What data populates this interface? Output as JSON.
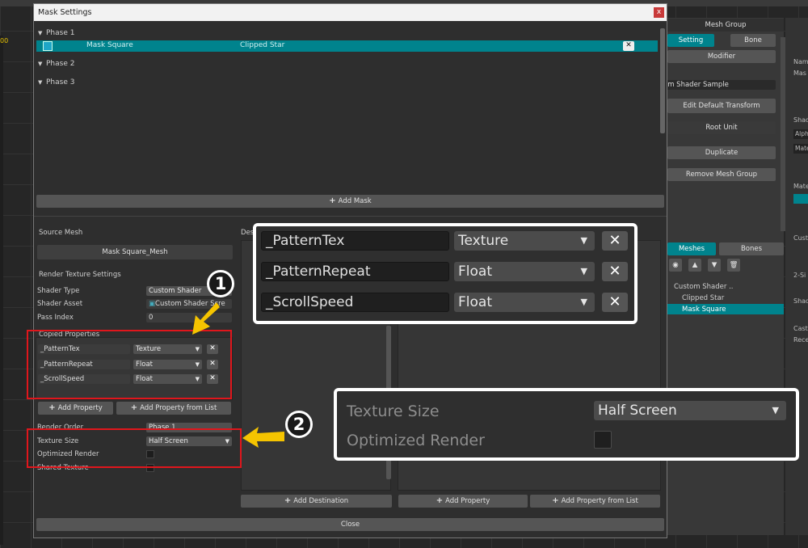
{
  "dialog": {
    "title": "Mask Settings",
    "close_glyph": "x",
    "phases": [
      {
        "label": "Phase 1",
        "expanded": true
      },
      {
        "label": "Phase 2",
        "expanded": true
      },
      {
        "label": "Phase 3",
        "expanded": true
      }
    ],
    "mask_row": {
      "name": "Mask Square",
      "target": "Clipped Star"
    },
    "add_mask": "Add Mask",
    "close_button": "Close"
  },
  "source": {
    "title": "Source Mesh",
    "mesh_name": "Mask Square_Mesh",
    "render_texture_settings": "Render Texture Settings",
    "shader_type_label": "Shader Type",
    "shader_type_value": "Custom Shader",
    "shader_asset_label": "Shader Asset",
    "shader_asset_value": "Custom Shader Scre",
    "pass_index_label": "Pass Index",
    "pass_index_value": "0",
    "copied_properties_label": "Copied Properties",
    "properties": [
      {
        "name": "_PatternTex",
        "type": "Texture"
      },
      {
        "name": "_PatternRepeat",
        "type": "Float"
      },
      {
        "name": "_ScrollSpeed",
        "type": "Float"
      }
    ],
    "add_property": "Add Property",
    "add_property_from_list": "Add Property from List",
    "render_order_label": "Render Order",
    "render_order_value": "Phase 1",
    "texture_size_label": "Texture Size",
    "texture_size_value": "Half Screen",
    "optimized_render_label": "Optimized Render",
    "shared_texture_label": "Shared Texture"
  },
  "destination": {
    "title_partial": "Des",
    "add_destination": "Add Destination",
    "add_property": "Add Property",
    "add_property_from_list": "Add Property from List"
  },
  "callouts": {
    "marker_1": "1",
    "marker_2": "2",
    "zoom1_rows": [
      {
        "name": "_PatternTex",
        "type": "Texture"
      },
      {
        "name": "_PatternRepeat",
        "type": "Float"
      },
      {
        "name": "_ScrollSpeed",
        "type": "Float"
      }
    ],
    "zoom2": {
      "texture_size_label": "Texture Size",
      "texture_size_value": "Half Screen",
      "optimized_render_label": "Optimized Render"
    }
  },
  "inspector": {
    "header": "Mesh Group",
    "tab_setting": "Setting",
    "tab_bone": "Bone",
    "modifier": "Modifier",
    "name_field": "om Shader Sample",
    "edit_default_transform": "Edit Default Transform",
    "root_unit": "Root Unit",
    "duplicate": "Duplicate",
    "remove_mesh_group": "Remove Mesh Group",
    "tab_meshes": "Meshes",
    "tab_bones": "Bones",
    "tree": [
      {
        "label": "Custom Shader ..",
        "selected": false
      },
      {
        "label": "Clipped Star",
        "selected": false
      },
      {
        "label": "Mask Square",
        "selected": true
      }
    ]
  },
  "far_right": {
    "labels": [
      "Nam",
      "Mas",
      "Shad",
      "Alph",
      "Mate",
      "Mate",
      "Cust",
      "2-Si",
      "Shad",
      "Cast",
      "Rece"
    ]
  },
  "background": {
    "y_marker": "00"
  },
  "colors": {
    "accent_teal": "#00838d",
    "highlight_red": "#e0161c",
    "arrow_yellow": "#f5c400"
  }
}
